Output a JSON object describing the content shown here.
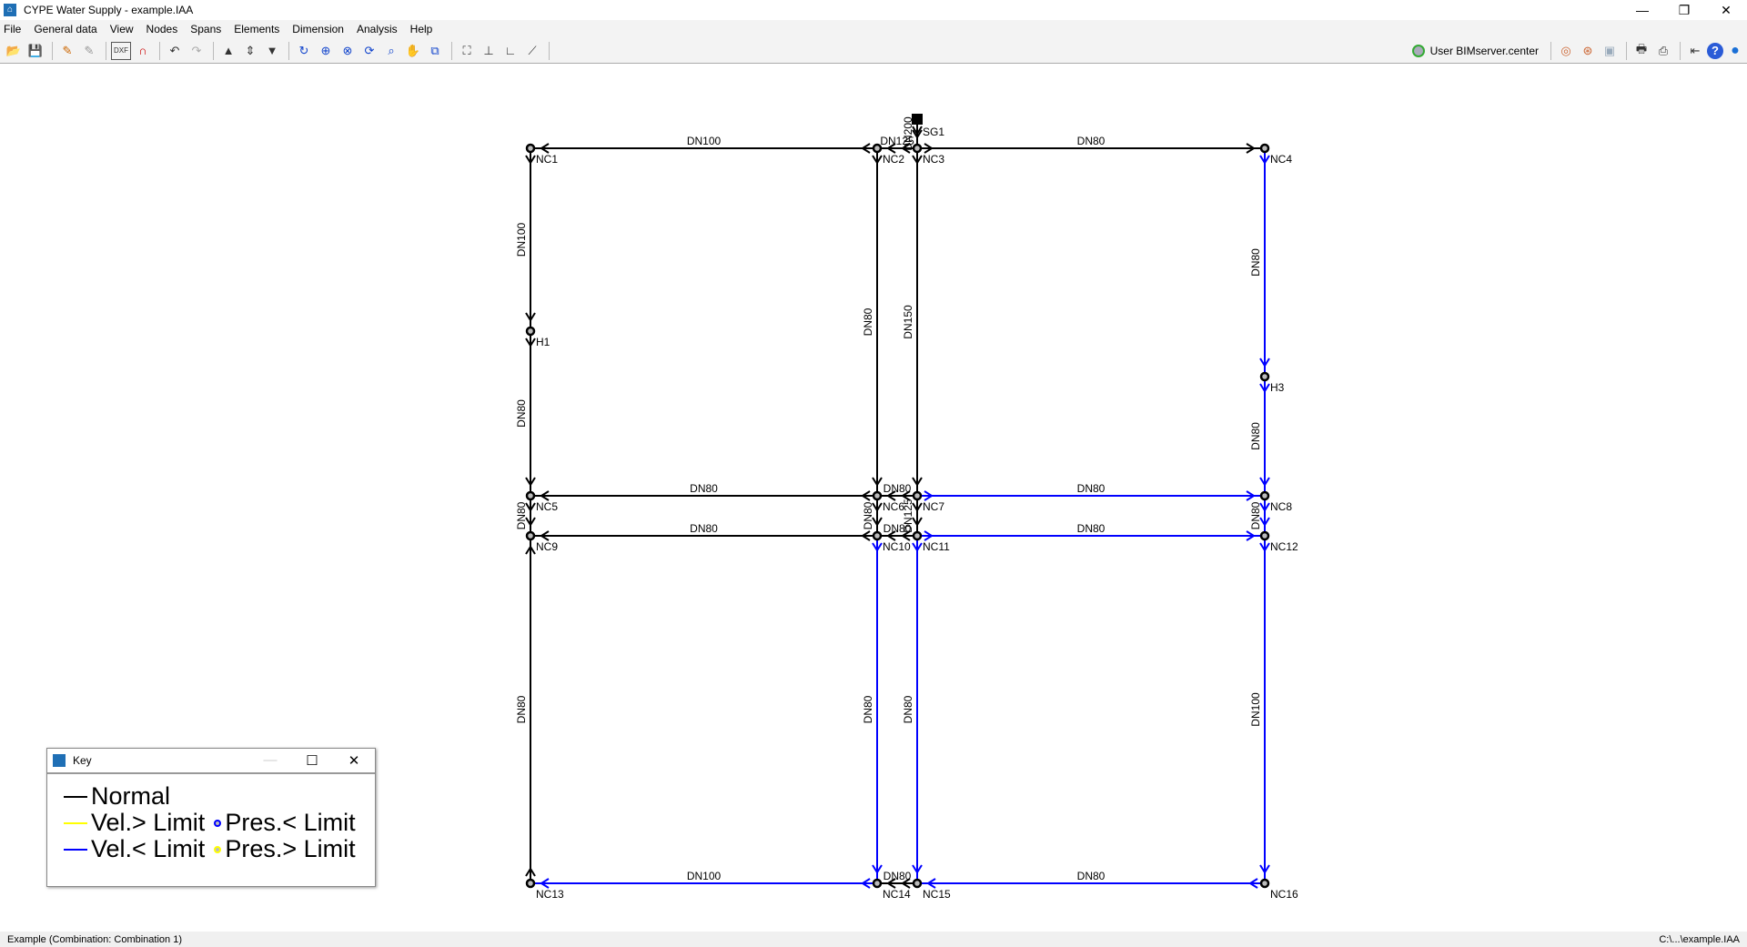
{
  "window": {
    "title": "CYPE Water Supply - example.IAA",
    "minimize": "—",
    "restore": "❐",
    "close": "✕"
  },
  "menu": [
    "File",
    "General data",
    "View",
    "Nodes",
    "Spans",
    "Elements",
    "Dimension",
    "Analysis",
    "Help"
  ],
  "toolbar": {
    "user": "User BIMserver.center"
  },
  "colors": {
    "normal": "#000000",
    "vel_high": "#ffff00",
    "vel_low": "#0000ff"
  },
  "nodes": [
    "SG1",
    "NC1",
    "NC2",
    "NC3",
    "NC4",
    "H1",
    "H3",
    "NC5",
    "NC6",
    "NC7",
    "NC8",
    "NC9",
    "NC10",
    "NC11",
    "NC12",
    "NC13",
    "NC14",
    "NC15",
    "NC16"
  ],
  "edges": [
    {
      "from": "SG1",
      "to": "NC3",
      "label": "DN200",
      "state": "normal"
    },
    {
      "from": "NC2",
      "to": "NC1",
      "label": "DN100",
      "state": "normal"
    },
    {
      "from": "NC3",
      "to": "NC2",
      "label": "DN125",
      "state": "normal"
    },
    {
      "from": "NC3",
      "to": "NC4",
      "label": "DN80",
      "state": "normal"
    },
    {
      "from": "NC1",
      "to": "H1",
      "label": "DN100",
      "state": "normal"
    },
    {
      "from": "H1",
      "to": "NC5",
      "label": "DN80",
      "state": "normal"
    },
    {
      "from": "NC2",
      "to": "NC6",
      "label": "DN80",
      "state": "normal"
    },
    {
      "from": "NC3",
      "to": "NC7",
      "label": "DN150",
      "state": "normal"
    },
    {
      "from": "NC4",
      "to": "H3",
      "label": "DN80",
      "state": "vel_low"
    },
    {
      "from": "H3",
      "to": "NC8",
      "label": "DN80",
      "state": "vel_low"
    },
    {
      "from": "NC6",
      "to": "NC5",
      "label": "DN80",
      "state": "normal"
    },
    {
      "from": "NC7",
      "to": "NC6",
      "label": "DN80",
      "state": "normal"
    },
    {
      "from": "NC7",
      "to": "NC8",
      "label": "DN80",
      "state": "vel_low"
    },
    {
      "from": "NC5",
      "to": "NC9",
      "label": "DN80",
      "state": "normal"
    },
    {
      "from": "NC6",
      "to": "NC10",
      "label": "DN80",
      "state": "normal"
    },
    {
      "from": "NC7",
      "to": "NC11",
      "label": "DN125",
      "state": "normal"
    },
    {
      "from": "NC8",
      "to": "NC12",
      "label": "DN80",
      "state": "vel_low"
    },
    {
      "from": "NC10",
      "to": "NC9",
      "label": "DN80",
      "state": "normal"
    },
    {
      "from": "NC11",
      "to": "NC10",
      "label": "DN80",
      "state": "normal"
    },
    {
      "from": "NC11",
      "to": "NC12",
      "label": "DN80",
      "state": "vel_low"
    },
    {
      "from": "NC13",
      "to": "NC9",
      "label": "DN80",
      "state": "normal"
    },
    {
      "from": "NC10",
      "to": "NC14",
      "label": "DN80",
      "state": "vel_low"
    },
    {
      "from": "NC11",
      "to": "NC15",
      "label": "DN80",
      "state": "vel_low"
    },
    {
      "from": "NC12",
      "to": "NC16",
      "label": "DN100",
      "state": "vel_low"
    },
    {
      "from": "NC14",
      "to": "NC13",
      "label": "DN100",
      "state": "vel_low"
    },
    {
      "from": "NC15",
      "to": "NC14",
      "label": "DN80",
      "state": "normal"
    },
    {
      "from": "NC16",
      "to": "NC15",
      "label": "DN80",
      "state": "vel_low"
    }
  ],
  "key": {
    "title": "Key",
    "normal": "Normal",
    "vel_high": "Vel.> Limit",
    "vel_low": "Vel.< Limit",
    "pres_low": "Pres.< Limit",
    "pres_high": "Pres.> Limit",
    "minimize": "—",
    "maximize": "☐",
    "close": "✕"
  },
  "status": {
    "left": "Example (Combination: Combination 1)",
    "right": "C:\\...\\example.IAA"
  }
}
